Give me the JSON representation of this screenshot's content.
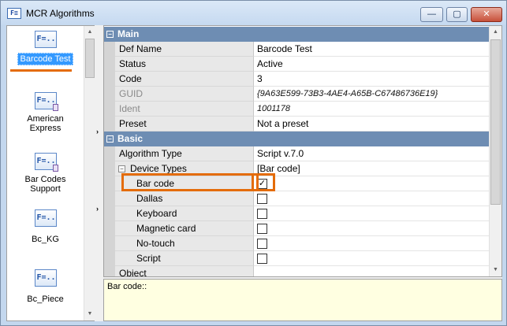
{
  "window": {
    "title": "MCR Algorithms",
    "app_icon_glyph": "F≡",
    "minimize": "—",
    "maximize": "▢",
    "close": "✕"
  },
  "colors": {
    "selection": "#3399ff",
    "highlight": "#e46c0a",
    "category": "#6e8db3",
    "description_bg": "#ffffe1"
  },
  "algorithms": [
    {
      "label": "Barcode Test",
      "icon": "script-icon",
      "selected": true
    },
    {
      "label": "American Express",
      "icon": "script-icon"
    },
    {
      "label": "Bar Codes Support",
      "icon": "script-icon"
    },
    {
      "label": "Bc_KG",
      "icon": "script-icon"
    },
    {
      "label": "Bc_Piece",
      "icon": "script-icon"
    }
  ],
  "grid": {
    "main_category": "Main",
    "basic_category": "Basic",
    "main_rows": [
      {
        "name": "Def Name",
        "value": "Barcode Test"
      },
      {
        "name": "Status",
        "value": "Active"
      },
      {
        "name": "Code",
        "value": "3"
      },
      {
        "name": "GUID",
        "value": "{9A63E599-73B3-4AE4-A65B-C67486736E19}"
      },
      {
        "name": "Ident",
        "value": "1001178"
      },
      {
        "name": "Preset",
        "value": "Not a preset"
      }
    ],
    "basic_rows": [
      {
        "name": "Algorithm Type",
        "value": "Script v.7.0"
      },
      {
        "name": "Device Types",
        "value": "[Bar code]"
      }
    ],
    "device_types": [
      {
        "name": "Bar code",
        "checked": true
      },
      {
        "name": "Dallas",
        "checked": false
      },
      {
        "name": "Keyboard",
        "checked": false
      },
      {
        "name": "Magnetic card",
        "checked": false
      },
      {
        "name": "No-touch",
        "checked": false
      },
      {
        "name": "Script",
        "checked": false
      }
    ],
    "last_row": {
      "name": "Object",
      "value": ""
    }
  },
  "description": "Bar code::"
}
